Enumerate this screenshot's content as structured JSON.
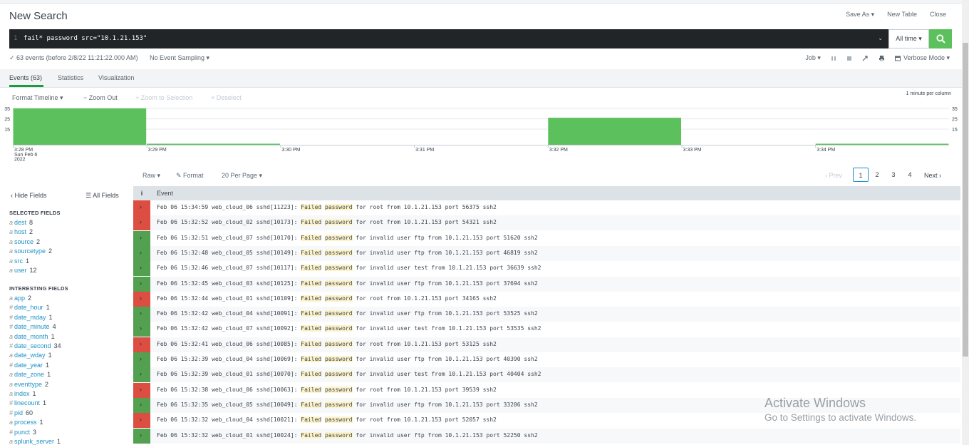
{
  "header": {
    "title": "New Search",
    "save_as": "Save As ▾",
    "new_table": "New Table",
    "close": "Close"
  },
  "search": {
    "line_number": "1",
    "query": "fail* password  src=\"10.1.21.153\"",
    "time_picker": "All time ▾"
  },
  "status": {
    "summary": "✓ 63 events (before 2/8/22 11:21:22.000 AM)",
    "sampling": "No Event Sampling ▾",
    "job": "Job ▾",
    "mode": "Verbose Mode ▾"
  },
  "tabs": [
    {
      "label": "Events (63)"
    },
    {
      "label": "Statistics"
    },
    {
      "label": "Visualization"
    }
  ],
  "timeline": {
    "format": "Format Timeline ▾",
    "zoom_out": "− Zoom Out",
    "zoom_selection": "+ Zoom to Selection",
    "deselect": "× Deselect",
    "per_column": "1 minute per column"
  },
  "chart_data": {
    "type": "bar",
    "categories": [
      "3:28 PM",
      "3:29 PM",
      "3:30 PM",
      "3:31 PM",
      "3:32 PM",
      "3:33 PM",
      "3:34 PM"
    ],
    "x_tick_labels": [
      "3:28 PM",
      "3:29 PM",
      "3:30 PM",
      "3:31 PM",
      "3:32 PM",
      "3:33 PM",
      "3:34 PM"
    ],
    "x_tick_sub": [
      "Sun Feb 6",
      "2022"
    ],
    "values": [
      35,
      1,
      0,
      0,
      26,
      0,
      1
    ],
    "y_ticks": [
      "35",
      "25",
      "15"
    ],
    "ylim": [
      0,
      35
    ],
    "color": "#5cc05c"
  },
  "pager": {
    "raw": "Raw ▾",
    "format": "✎ Format",
    "per_page": "20 Per Page ▾",
    "prev": "‹ Prev",
    "pages": [
      "1",
      "2",
      "3",
      "4"
    ],
    "next": "Next ›"
  },
  "sidebar": {
    "hide_fields": "‹ Hide Fields",
    "all_fields": "☰ All Fields",
    "selected_header": "SELECTED FIELDS",
    "selected": [
      {
        "type": "a",
        "name": "dest",
        "count": "8"
      },
      {
        "type": "a",
        "name": "host",
        "count": "2"
      },
      {
        "type": "a",
        "name": "source",
        "count": "2"
      },
      {
        "type": "a",
        "name": "sourcetype",
        "count": "2"
      },
      {
        "type": "a",
        "name": "src",
        "count": "1"
      },
      {
        "type": "a",
        "name": "user",
        "count": "12"
      }
    ],
    "interesting_header": "INTERESTING FIELDS",
    "interesting": [
      {
        "type": "a",
        "name": "app",
        "count": "2"
      },
      {
        "type": "#",
        "name": "date_hour",
        "count": "1"
      },
      {
        "type": "#",
        "name": "date_mday",
        "count": "1"
      },
      {
        "type": "#",
        "name": "date_minute",
        "count": "4"
      },
      {
        "type": "a",
        "name": "date_month",
        "count": "1"
      },
      {
        "type": "#",
        "name": "date_second",
        "count": "34"
      },
      {
        "type": "a",
        "name": "date_wday",
        "count": "1"
      },
      {
        "type": "#",
        "name": "date_year",
        "count": "1"
      },
      {
        "type": "a",
        "name": "date_zone",
        "count": "1"
      },
      {
        "type": "a",
        "name": "eventtype",
        "count": "2"
      },
      {
        "type": "a",
        "name": "index",
        "count": "1"
      },
      {
        "type": "#",
        "name": "linecount",
        "count": "1"
      },
      {
        "type": "#",
        "name": "pid",
        "count": "60"
      },
      {
        "type": "a",
        "name": "process",
        "count": "1"
      },
      {
        "type": "#",
        "name": "punct",
        "count": "3"
      },
      {
        "type": "a",
        "name": "splunk_server",
        "count": "1"
      }
    ]
  },
  "events_header": {
    "i": "i",
    "event": "Event"
  },
  "events": [
    {
      "status": "red",
      "pre": "Feb 06 15:34:59 web_cloud_06 sshd[11223]: ",
      "w1": "Failed",
      "w2": "password",
      "post": " for root from 10.1.21.153 port 56375 ssh2"
    },
    {
      "status": "red",
      "pre": "Feb 06 15:32:52 web_cloud_02 sshd[10173]: ",
      "w1": "Failed",
      "w2": "password",
      "post": " for root from 10.1.21.153 port 54321 ssh2"
    },
    {
      "status": "green",
      "pre": "Feb 06 15:32:51 web_cloud_07 sshd[10170]: ",
      "w1": "Failed",
      "w2": "password",
      "post": " for invalid user ftp from 10.1.21.153 port 51620 ssh2"
    },
    {
      "status": "green",
      "pre": "Feb 06 15:32:48 web_cloud_05 sshd[10149]: ",
      "w1": "Failed",
      "w2": "password",
      "post": " for invalid user ftp from 10.1.21.153 port 46819 ssh2"
    },
    {
      "status": "green",
      "pre": "Feb 06 15:32:46 web_cloud_07 sshd[10117]: ",
      "w1": "Failed",
      "w2": "password",
      "post": " for invalid user test from 10.1.21.153 port 36639 ssh2"
    },
    {
      "status": "green",
      "pre": "Feb 06 15:32:45 web_cloud_03 sshd[10125]: ",
      "w1": "Failed",
      "w2": "password",
      "post": " for invalid user ftp from 10.1.21.153 port 37694 ssh2"
    },
    {
      "status": "red",
      "pre": "Feb 06 15:32:44 web_cloud_01 sshd[10109]: ",
      "w1": "Failed",
      "w2": "password",
      "post": " for root from 10.1.21.153 port 34165 ssh2"
    },
    {
      "status": "green",
      "pre": "Feb 06 15:32:42 web_cloud_04 sshd[10091]: ",
      "w1": "Failed",
      "w2": "password",
      "post": " for invalid user ftp from 10.1.21.153 port 53525 ssh2"
    },
    {
      "status": "green",
      "pre": "Feb 06 15:32:42 web_cloud_07 sshd[10092]: ",
      "w1": "Failed",
      "w2": "password",
      "post": " for invalid user test from 10.1.21.153 port 53535 ssh2"
    },
    {
      "status": "red",
      "pre": "Feb 06 15:32:41 web_cloud_06 sshd[10085]: ",
      "w1": "Failed",
      "w2": "password",
      "post": " for root from 10.1.21.153 port 53125 ssh2"
    },
    {
      "status": "green",
      "pre": "Feb 06 15:32:39 web_cloud_04 sshd[10069]: ",
      "w1": "Failed",
      "w2": "password",
      "post": " for invalid user ftp from 10.1.21.153 port 40390 ssh2"
    },
    {
      "status": "green",
      "pre": "Feb 06 15:32:39 web_cloud_01 sshd[10070]: ",
      "w1": "Failed",
      "w2": "password",
      "post": " for invalid user test from 10.1.21.153 port 40404 ssh2"
    },
    {
      "status": "red",
      "pre": "Feb 06 15:32:38 web_cloud_06 sshd[10063]: ",
      "w1": "Failed",
      "w2": "password",
      "post": " for root from 10.1.21.153 port 39539 ssh2"
    },
    {
      "status": "green",
      "pre": "Feb 06 15:32:35 web_cloud_05 sshd[10049]: ",
      "w1": "Failed",
      "w2": "password",
      "post": " for invalid user ftp from 10.1.21.153 port 33206 ssh2"
    },
    {
      "status": "red",
      "pre": "Feb 06 15:32:32 web_cloud_04 sshd[10021]: ",
      "w1": "Failed",
      "w2": "password",
      "post": " for root from 10.1.21.153 port 52057 ssh2"
    },
    {
      "status": "green",
      "pre": "Feb 06 15:32:32 web_cloud_01 sshd[10024]: ",
      "w1": "Failed",
      "w2": "password",
      "post": " for invalid user ftp from 10.1.21.153 port 52250 ssh2"
    }
  ],
  "watermark": {
    "line1": "Activate Windows",
    "line2": "Go to Settings to activate Windows."
  }
}
